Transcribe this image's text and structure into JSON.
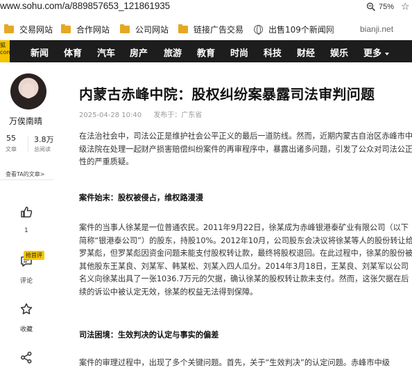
{
  "browser": {
    "url": "www.sohu.com/a/889857653_121861935",
    "zoom": "75%"
  },
  "bookmarks": {
    "items": [
      {
        "label": "交易网站",
        "icon": "folder-icon"
      },
      {
        "label": "合作网站",
        "icon": "folder-icon"
      },
      {
        "label": "公司网站",
        "icon": "folder-icon"
      },
      {
        "label": "链接广告交易",
        "icon": "folder-icon"
      },
      {
        "label": "出售109个新闻网",
        "icon": "globe-icon"
      }
    ],
    "bianji": "bianji.net"
  },
  "nav": {
    "logo": "狐 com",
    "items": [
      "新闻",
      "体育",
      "汽车",
      "房产",
      "旅游",
      "教育",
      "时尚",
      "科技",
      "财经",
      "娱乐",
      "更多"
    ]
  },
  "author": {
    "name": "万俟南晴",
    "articles_count": "55",
    "articles_label": "文章",
    "views_count": "3.8万",
    "views_label": "总阅读",
    "view_articles": "查看TA的文章>"
  },
  "actions": {
    "like_count": "1",
    "comment_badge": "抢首评",
    "comment_label": "评论",
    "favorite_label": "收藏"
  },
  "article": {
    "title": "内蒙古赤峰中院：股权纠纷案暴露司法审判问题",
    "date": "2025-04-28 10:40",
    "published_in": "发布于：广东省",
    "intro": "在法治社会中，司法公正是维护社会公平正义的最后一道防线。然而，近期内蒙古自治区赤峰市中级法院在处理一起财产损害赔偿纠纷案件的再审程序中，暴露出诸多问题，引发了公众对司法公正性的严重质疑。",
    "heading1": "案件始末：股权被侵占，维权路漫漫",
    "para1": "案件的当事人徐某是一位普通农民。2011年9月22日，徐某成为赤峰银港泰矿业有限公司（以下简称“银港泰公司”）的股东，持股10%。2012年10月，公司股东会决议将徐某等人的股份转让给罗某彪，但罗某彪因资金问题未能支付股权转让款，最终将股权退回。在此过程中，徐某的股份被其他股东王某良、刘某军、韩某松、刘某入四人瓜分。2014年3月18日，王某良、刘某军以公司名义向徐某出具了一张1036.7万元的欠据，确认徐某的股权转让款未支付。然而，这张欠据在后续的诉讼中被认定无效，徐某的权益无法得到保障。",
    "heading2": "司法困境：生效判决的认定与事实的偏差",
    "para2": "案件的审理过程中，出现了多个关键问题。首先，关于“生效判决”的认定问题。赤峰市中级"
  },
  "colors": {
    "nav_bg": "#1d1d1d",
    "brand_yellow": "#f5c400",
    "folder": "#e5a823"
  }
}
